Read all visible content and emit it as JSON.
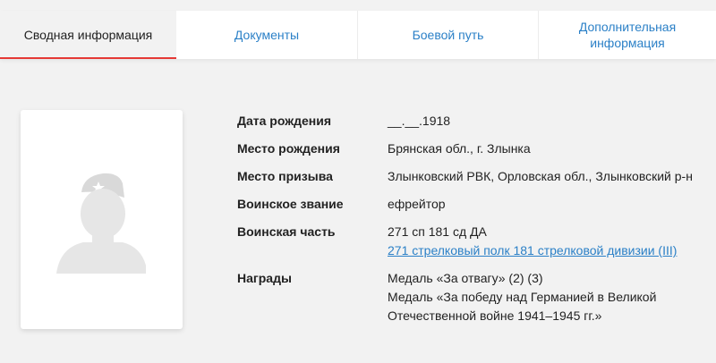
{
  "tabs": [
    {
      "label": "Сводная информация",
      "active": true
    },
    {
      "label": "Документы",
      "active": false
    },
    {
      "label": "Боевой путь",
      "active": false
    },
    {
      "label": "Дополнительная информация",
      "active": false
    }
  ],
  "photo": {
    "icon": "soldier-placeholder-icon"
  },
  "fields": {
    "birth_date": {
      "label": "Дата рождения",
      "value": "__.__.1918"
    },
    "birth_place": {
      "label": "Место рождения",
      "value": "Брянская обл., г. Злынка"
    },
    "conscription_place": {
      "label": "Место призыва",
      "value": "Злынковский РВК, Орловская обл., Злынковский р-н"
    },
    "rank": {
      "label": "Воинское звание",
      "value": "ефрейтор"
    },
    "unit": {
      "label": "Воинская часть",
      "value": "271 сп 181 сд ДА",
      "link": "271 стрелковый полк 181 стрелковой дивизии (III)"
    },
    "awards": {
      "label": "Награды",
      "items": [
        "Медаль «За отвагу» (2) (3)",
        "Медаль «За победу над Германией в Великой Отечественной войне 1941–1945 гг.»"
      ]
    }
  },
  "colors": {
    "accent": "#e53935",
    "link": "#2b80c7",
    "background": "#f2f2f2"
  }
}
